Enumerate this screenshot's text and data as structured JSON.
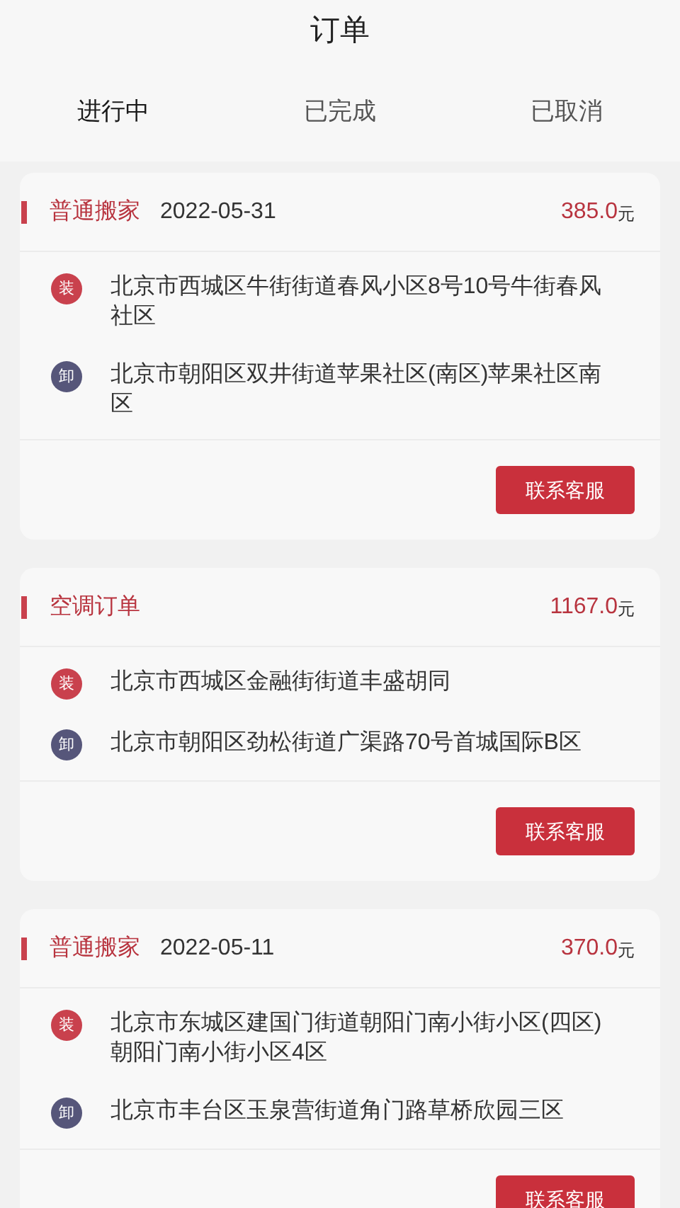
{
  "title": "订单",
  "tabs": [
    {
      "label": "进行中",
      "selected": true
    },
    {
      "label": "已完成",
      "selected": false
    },
    {
      "label": "已取消",
      "selected": false
    }
  ],
  "orders": [
    {
      "type": "普通搬家",
      "date": "2022-05-31",
      "price": "385.0",
      "unit": "元",
      "stops": [
        {
          "kind": "load",
          "badge": "装",
          "address": "北京市西城区牛街街道春风小区8号10号牛街春风社区"
        },
        {
          "kind": "unload",
          "badge": "卸",
          "address": "北京市朝阳区双井街道苹果社区(南区)苹果社区南区"
        }
      ],
      "button": "联系客服"
    },
    {
      "type": "空调订单",
      "price": "1167.0",
      "unit": "元",
      "stops": [
        {
          "kind": "load",
          "badge": "装",
          "address": "北京市西城区金融街街道丰盛胡同"
        },
        {
          "kind": "unload",
          "badge": "卸",
          "address": "北京市朝阳区劲松街道广渠路70号首城国际B区"
        }
      ],
      "button": "联系客服"
    },
    {
      "type": "普通搬家",
      "date": "2022-05-11",
      "price": "370.0",
      "unit": "元",
      "stops": [
        {
          "kind": "load",
          "badge": "装",
          "address": "北京市东城区建国门街道朝阳门南小街小区(四区)朝阳门南小街小区4区"
        },
        {
          "kind": "unload",
          "badge": "卸",
          "address": "北京市丰台区玉泉营街道角门路草桥欣园三区"
        }
      ],
      "button": "联系客服"
    }
  ]
}
